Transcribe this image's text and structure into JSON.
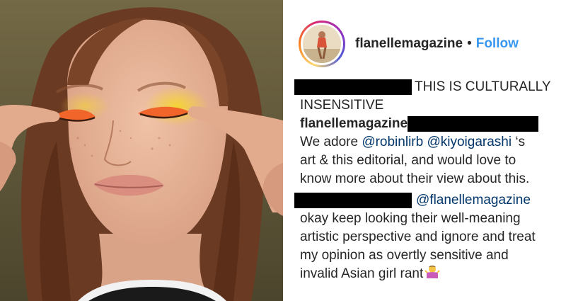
{
  "post": {
    "username": "flanellemagazine",
    "separator": "•",
    "follow_label": "Follow"
  },
  "photo": {
    "subject": "Model with bright orange and yellow eyeshadow, fingertips pulling at the outer corners of her closed eyes",
    "colors": {
      "background": "#5f573a",
      "skin": "#e8b59a",
      "hair": "#6b3a22",
      "eyeshadow_orange": "#f2652a",
      "eyeshadow_yellow": "#f3cd2a"
    }
  },
  "comments": [
    {
      "redacted_user": true,
      "text_lines": [
        "THIS IS CULTURALLY",
        "INSENSITIVE"
      ]
    },
    {
      "author": "flanellemagazine",
      "redacted_mention": true,
      "parts": [
        {
          "text": "We adore "
        },
        {
          "mention": "@robinlirb"
        },
        {
          "text": " "
        },
        {
          "mention": "@kiyoigarashi"
        },
        {
          "text": " ‘s"
        }
      ],
      "continuation": [
        "art & this editorial, and would love to",
        "know more about their view about this."
      ]
    },
    {
      "redacted_user": true,
      "mention": "@flanellemagazine",
      "text_lines": [
        "okay keep looking their well-meaning",
        "artistic perspective and ignore and treat",
        "my opinion as overtly sensitive and",
        "invalid Asian girl rant"
      ],
      "emoji": "woman-shrugging-emoji"
    }
  ]
}
